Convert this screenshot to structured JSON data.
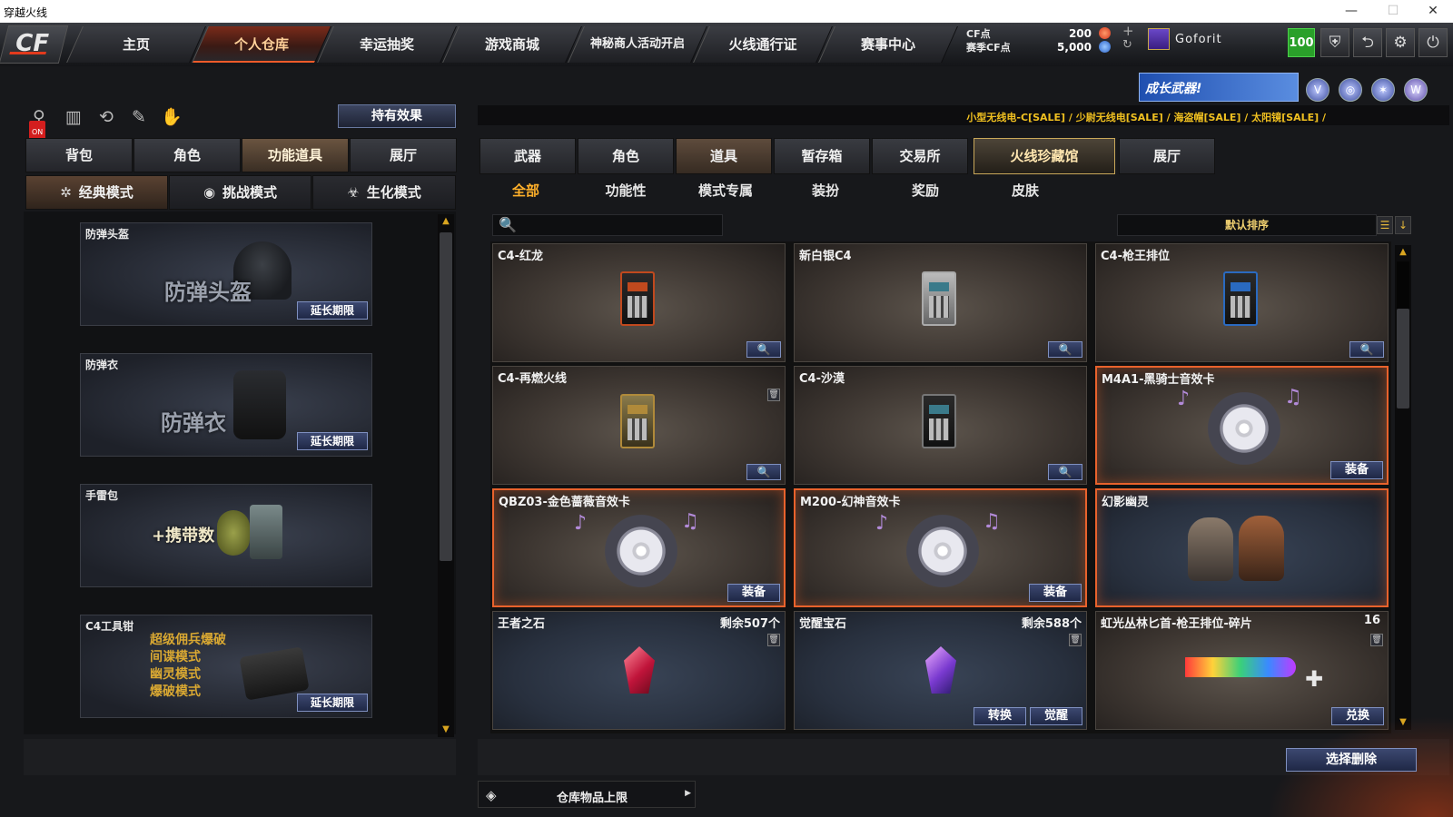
{
  "window": {
    "title": "穿越火线"
  },
  "nav": {
    "logo": "CF",
    "tabs": [
      "主页",
      "个人仓库",
      "幸运抽奖",
      "游戏商城",
      "神秘商人活动开启",
      "火线通行证",
      "赛事中心"
    ],
    "active_index": 1
  },
  "currency": {
    "cf_label": "CF点",
    "cf_value": "200",
    "match_label": "赛季CF点",
    "match_value": "5,000"
  },
  "user": {
    "name": "Goforit",
    "level": "100"
  },
  "banner": {
    "text": "成长武器!"
  },
  "ticker": {
    "text": "小型无线电-C[SALE] / 少尉无线电[SALE] / 海盗帽[SALE] / 太阳镜[SALE] /"
  },
  "left": {
    "effect_button": "持有效果",
    "tabs": [
      "背包",
      "角色",
      "功能道具",
      "展厅"
    ],
    "active_tab": 2,
    "modes": [
      "经典模式",
      "挑战模式",
      "生化模式"
    ],
    "active_mode": 0,
    "items": [
      {
        "title": "防弹头盔",
        "big": "防弹头盔",
        "action": "延长期限"
      },
      {
        "title": "防弹衣",
        "big": "防弹衣",
        "action": "延长期限"
      },
      {
        "title": "手雷包",
        "big": "+携带数",
        "action": ""
      },
      {
        "title": "C4工具钳",
        "big": "",
        "lines": [
          "超级佣兵爆破",
          "间谍模式",
          "幽灵模式",
          "爆破模式"
        ],
        "action": "延长期限"
      }
    ]
  },
  "right": {
    "tabs": [
      "武器",
      "角色",
      "道具",
      "暂存箱",
      "交易所",
      "火线珍藏馆",
      "展厅"
    ],
    "active_tab": 2,
    "highlight_tab": 5,
    "subtabs": [
      "全部",
      "功能性",
      "模式专属",
      "装扮",
      "奖励",
      "皮肤"
    ],
    "active_subtab": 0,
    "search_placeholder": "",
    "sort_label": "默认排序",
    "items": [
      {
        "name": "C4-红龙",
        "buttons": [
          "🔍"
        ],
        "type": "c4"
      },
      {
        "name": "新白银C4",
        "buttons": [
          "🔍"
        ],
        "type": "c4"
      },
      {
        "name": "C4-枪王排位",
        "buttons": [
          "🔍"
        ],
        "type": "c4"
      },
      {
        "name": "C4-再燃火线",
        "buttons": [
          "🔍"
        ],
        "type": "c4"
      },
      {
        "name": "C4-沙漠",
        "buttons": [
          "🔍"
        ],
        "type": "c4"
      },
      {
        "name": "M4A1-黑骑士音效卡",
        "buttons": [
          "装备"
        ],
        "type": "cd"
      },
      {
        "name": "QBZ03-金色蔷薇音效卡",
        "buttons": [
          "装备"
        ],
        "type": "cd"
      },
      {
        "name": "M200-幻神音效卡",
        "buttons": [
          "装备"
        ],
        "type": "cd"
      },
      {
        "name": "幻影幽灵",
        "buttons": [],
        "type": "char"
      },
      {
        "name": "王者之石",
        "remain": "剩余507个",
        "buttons": [],
        "type": "gem-red"
      },
      {
        "name": "觉醒宝石",
        "remain": "剩余588个",
        "buttons": [
          "转换",
          "觉醒"
        ],
        "type": "gem-purple"
      },
      {
        "name": "虹光丛林匕首-枪王排位-碎片",
        "remain": "16",
        "buttons": [
          "兑换"
        ],
        "type": "knife"
      }
    ],
    "delete_button": "选择删除",
    "capacity_label": "仓库物品上限"
  },
  "colors": {
    "accent": "#f45b2a",
    "gold": "#f0c020",
    "button_blue": "#1f2846",
    "highlight_border": "#e8622c"
  },
  "icons": [
    "search-icon",
    "minimize-icon",
    "maximize-icon",
    "close-icon",
    "shield-icon",
    "share-icon",
    "gear-icon",
    "power-icon",
    "layers-icon",
    "trash-icon",
    "sort-icon",
    "plus-icon",
    "refresh-icon"
  ]
}
